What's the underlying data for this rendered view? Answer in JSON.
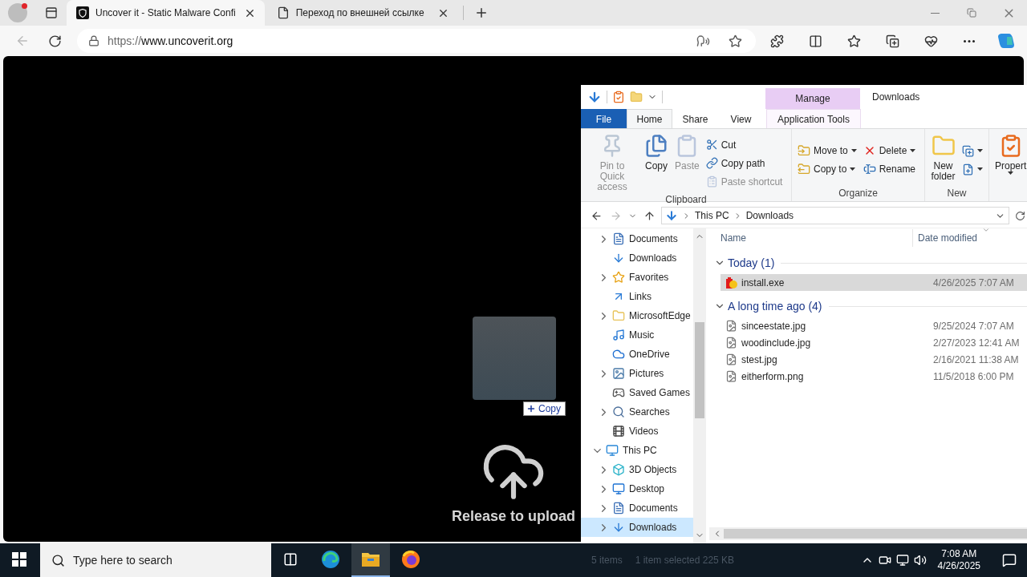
{
  "browser": {
    "tabs": [
      {
        "title": "Uncover it - Static Malware Confi",
        "kind": "site",
        "selected": true
      },
      {
        "title": "Переход по внешней ссылке",
        "kind": "page",
        "selected": false
      }
    ],
    "address": {
      "scheme": "https://",
      "host": "www.uncoverit.org"
    }
  },
  "drop_zone": {
    "badge": "Copy",
    "message": "Release to upload"
  },
  "explorer": {
    "title": "Downloads",
    "context_group": "Manage",
    "tabs": [
      {
        "label": "File",
        "kind": "file",
        "selected": false
      },
      {
        "label": "Home",
        "kind": "tab",
        "selected": true
      },
      {
        "label": "Share",
        "kind": "tab",
        "selected": false
      },
      {
        "label": "View",
        "kind": "tab",
        "selected": false
      },
      {
        "label": "Application Tools",
        "kind": "context",
        "selected": false
      }
    ],
    "ribbon": [
      {
        "label": "Clipboard",
        "columns": [
          {
            "kind": "large",
            "buttons": [
              {
                "label": "Pin to Quick access",
                "disabled": true,
                "dropdown": false
              }
            ]
          },
          {
            "kind": "large",
            "buttons": [
              {
                "label": "Copy",
                "disabled": false,
                "dropdown": false
              }
            ]
          },
          {
            "kind": "large",
            "buttons": [
              {
                "label": "Paste",
                "disabled": true,
                "dropdown": false
              }
            ]
          },
          {
            "kind": "small",
            "buttons": [
              {
                "label": "Cut",
                "disabled": false,
                "dropdown": false
              },
              {
                "label": "Copy path",
                "disabled": false,
                "dropdown": false
              },
              {
                "label": "Paste shortcut",
                "disabled": true,
                "dropdown": false
              }
            ]
          }
        ]
      },
      {
        "label": "Organize",
        "columns": [
          {
            "kind": "small",
            "buttons": [
              {
                "label": "Move to",
                "disabled": false,
                "dropdown": true
              },
              {
                "label": "Copy to",
                "disabled": false,
                "dropdown": true
              }
            ]
          },
          {
            "kind": "small",
            "buttons": [
              {
                "label": "Delete",
                "disabled": false,
                "dropdown": true
              },
              {
                "label": "Rename",
                "disabled": false,
                "dropdown": false
              }
            ]
          }
        ]
      },
      {
        "label": "New",
        "columns": [
          {
            "kind": "large",
            "buttons": [
              {
                "label": "New folder",
                "disabled": false,
                "dropdown": false
              }
            ]
          },
          {
            "kind": "small",
            "buttons": [
              {
                "disabled": false,
                "dropdown": true
              },
              {
                "disabled": false,
                "dropdown": true
              }
            ]
          }
        ]
      },
      {
        "columns": [
          {
            "kind": "large",
            "buttons": [
              {
                "label": "Propert",
                "disabled": false,
                "dropdown": true
              }
            ]
          }
        ]
      }
    ],
    "breadcrumb": [
      "This PC",
      "Downloads"
    ],
    "nav_pane": [
      {
        "children": [
          {
            "label": "Documents",
            "kind": "documents",
            "expandable": true,
            "selected": false
          },
          {
            "label": "Downloads",
            "kind": "downloads",
            "expandable": false,
            "selected": false
          },
          {
            "label": "Favorites",
            "kind": "favorites",
            "expandable": true,
            "selected": false
          },
          {
            "label": "Links",
            "kind": "links",
            "expandable": false,
            "selected": false
          },
          {
            "label": "MicrosoftEdge",
            "kind": "folder",
            "expandable": true,
            "selected": false
          },
          {
            "label": "Music",
            "kind": "music",
            "expandable": false,
            "selected": false
          },
          {
            "label": "OneDrive",
            "kind": "onedrive",
            "expandable": false,
            "selected": false
          },
          {
            "label": "Pictures",
            "kind": "pictures",
            "expandable": true,
            "selected": false
          },
          {
            "label": "Saved Games",
            "kind": "games",
            "expandable": false,
            "selected": false
          },
          {
            "label": "Searches",
            "kind": "searches",
            "expandable": true,
            "selected": false
          },
          {
            "label": "Videos",
            "kind": "videos",
            "expandable": false,
            "selected": false
          }
        ]
      },
      {
        "label": "This PC",
        "kind": "pc",
        "expanded": true,
        "selected": false,
        "children": [
          {
            "label": "3D Objects",
            "kind": "objects",
            "expandable": true,
            "selected": false
          },
          {
            "label": "Desktop",
            "kind": "desktop",
            "expandable": true,
            "selected": false
          },
          {
            "label": "Documents",
            "kind": "documents",
            "expandable": true,
            "selected": false
          },
          {
            "label": "Downloads",
            "kind": "downloads",
            "expandable": true,
            "selected": true
          }
        ]
      }
    ],
    "columns": [
      "Name",
      "Date modified"
    ],
    "groups": [
      {
        "label": "Today (1)",
        "expanded": true,
        "files": [
          {
            "name": "install.exe",
            "date": "4/26/2025 7:07 AM",
            "kind": "exe",
            "selected": true
          }
        ]
      },
      {
        "label": "A long time ago (4)",
        "expanded": true,
        "files": [
          {
            "name": "sinceestate.jpg",
            "date": "9/25/2024 7:07 AM",
            "kind": "image",
            "selected": false
          },
          {
            "name": "woodinclude.jpg",
            "date": "2/27/2023 12:41 AM",
            "kind": "image",
            "selected": false
          },
          {
            "name": "stest.jpg",
            "date": "2/16/2021 11:38 AM",
            "kind": "image",
            "selected": false
          },
          {
            "name": "eitherform.png",
            "date": "11/5/2018 6:00 PM",
            "kind": "image",
            "selected": false
          }
        ]
      }
    ],
    "status_bar": {
      "count": "5 items",
      "selection": "1 item selected  225 KB"
    }
  },
  "taskbar": {
    "search_placeholder": "Type here to search",
    "apps": [
      {
        "kind": "edge",
        "active": false
      },
      {
        "kind": "explorer",
        "active": true
      },
      {
        "kind": "firefox",
        "active": false
      }
    ],
    "time": "7:08 AM",
    "date": "4/26/2025"
  }
}
